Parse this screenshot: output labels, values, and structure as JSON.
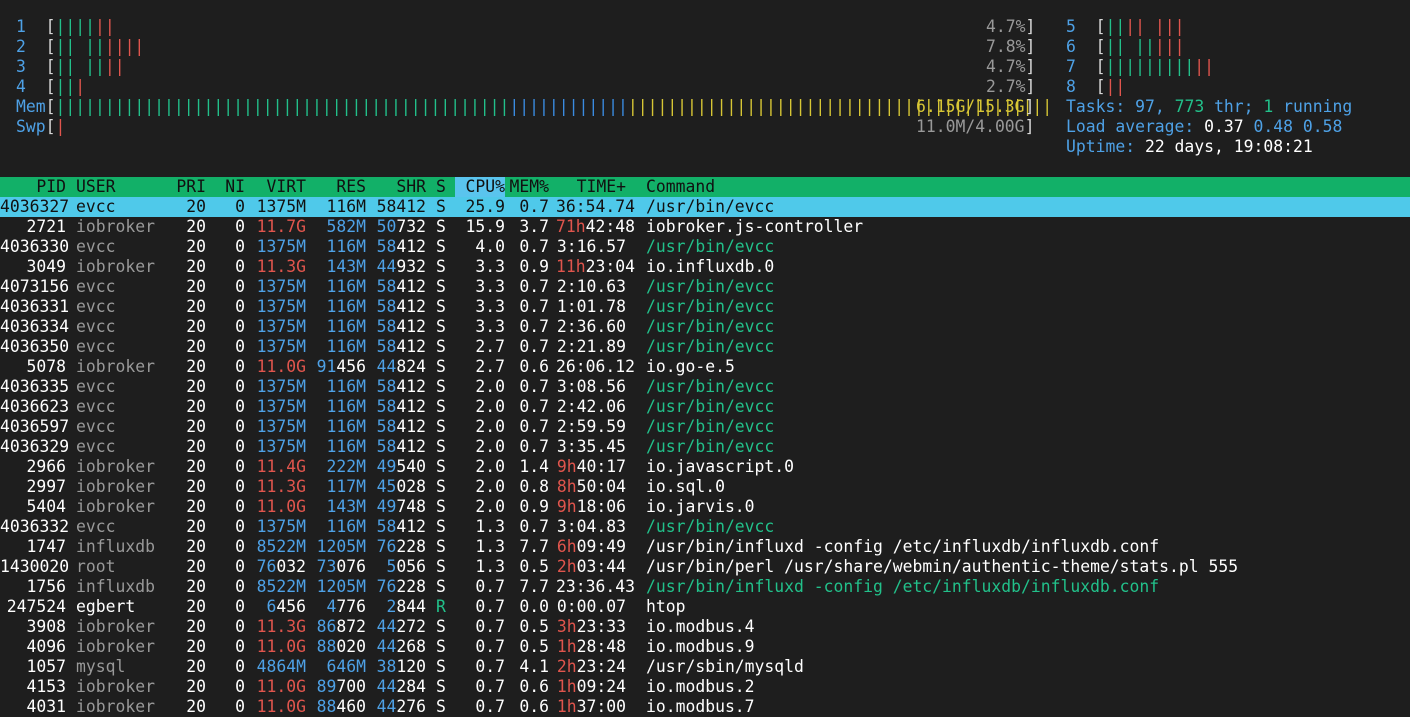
{
  "cpus": [
    {
      "id": "1",
      "green": "||||",
      "red": "||",
      "pct": "4.7%"
    },
    {
      "id": "2",
      "green": "|| ||",
      "red": "||||",
      "pct": "7.8%"
    },
    {
      "id": "3",
      "green": "|| ||",
      "red": "||",
      "pct": "4.7%"
    },
    {
      "id": "4",
      "green": "||",
      "red": "|",
      "pct": "2.7%"
    },
    {
      "id": "5",
      "green": "||",
      "red": "|| |||",
      "pct": ""
    },
    {
      "id": "6",
      "green": "|| ||",
      "red": "|||",
      "pct": ""
    },
    {
      "id": "7",
      "green": "|||||||||",
      "red": "||",
      "pct": ""
    },
    {
      "id": "8",
      "green": "",
      "red": "||",
      "pct": ""
    }
  ],
  "mem": {
    "label": "Mem",
    "green": "||||||||||||||||||||||||||||||||||||||||||||||",
    "blue": "||||||||||||",
    "yellow": "|||||||||||||||||||||||||||||||||||||||||||",
    "value": "6.15G/15.3G"
  },
  "swp": {
    "label": "Swp",
    "red": "|",
    "value": "11.0M/4.00G"
  },
  "tasks": {
    "label": "Tasks:",
    "value": "97,",
    "thr": "773",
    "thr_label": "thr;",
    "running": "1",
    "running_label": "running"
  },
  "load": {
    "label": "Load average:",
    "v1": "0.37",
    "v2": "0.48",
    "v3": "0.58"
  },
  "uptime": {
    "label": "Uptime:",
    "value": "22 days, 19:08:21"
  },
  "header": {
    "pid": "PID",
    "user": "USER",
    "pri": "PRI",
    "ni": "NI",
    "virt": "VIRT",
    "res": "RES",
    "shr": "SHR",
    "s": "S",
    "cpu": "CPU%",
    "mem": "MEM%",
    "time": "TIME+",
    "command": "Command"
  },
  "processes": [
    {
      "pid": "4036327",
      "user": "evcc",
      "pri": "20",
      "ni": "0",
      "virt": "1375M",
      "res": "116M",
      "shr": "58412",
      "s": "S",
      "cpu": "25.9",
      "mem": "0.7",
      "time_h": "",
      "time": "36:54.74",
      "cmd": "/usr/bin/evcc",
      "cmd_args": "",
      "thread": false
    },
    {
      "pid": "2721",
      "user": "iobroker",
      "pri": "20",
      "ni": "0",
      "virt": "11.7G",
      "res": "582M",
      "shr": "50732",
      "s": "S",
      "cpu": "15.9",
      "mem": "3.7",
      "time_h": "71h",
      "time": "42:48",
      "cmd": "iobroker.js-controller",
      "cmd_args": "",
      "thread": false
    },
    {
      "pid": "4036330",
      "user": "evcc",
      "pri": "20",
      "ni": "0",
      "virt": "1375M",
      "res": "116M",
      "shr": "58412",
      "s": "S",
      "cpu": "4.0",
      "mem": "0.7",
      "time_h": "",
      "time": "3:16.57",
      "cmd": "/usr/bin/evcc",
      "cmd_args": "",
      "thread": true
    },
    {
      "pid": "3049",
      "user": "iobroker",
      "pri": "20",
      "ni": "0",
      "virt": "11.3G",
      "res": "143M",
      "shr": "44932",
      "s": "S",
      "cpu": "3.3",
      "mem": "0.9",
      "time_h": "11h",
      "time": "23:04",
      "cmd": "io.influxdb.0",
      "cmd_args": "",
      "thread": false
    },
    {
      "pid": "4073156",
      "user": "evcc",
      "pri": "20",
      "ni": "0",
      "virt": "1375M",
      "res": "116M",
      "shr": "58412",
      "s": "S",
      "cpu": "3.3",
      "mem": "0.7",
      "time_h": "",
      "time": "2:10.63",
      "cmd": "/usr/bin/evcc",
      "cmd_args": "",
      "thread": true
    },
    {
      "pid": "4036331",
      "user": "evcc",
      "pri": "20",
      "ni": "0",
      "virt": "1375M",
      "res": "116M",
      "shr": "58412",
      "s": "S",
      "cpu": "3.3",
      "mem": "0.7",
      "time_h": "",
      "time": "1:01.78",
      "cmd": "/usr/bin/evcc",
      "cmd_args": "",
      "thread": true
    },
    {
      "pid": "4036334",
      "user": "evcc",
      "pri": "20",
      "ni": "0",
      "virt": "1375M",
      "res": "116M",
      "shr": "58412",
      "s": "S",
      "cpu": "3.3",
      "mem": "0.7",
      "time_h": "",
      "time": "2:36.60",
      "cmd": "/usr/bin/evcc",
      "cmd_args": "",
      "thread": true
    },
    {
      "pid": "4036350",
      "user": "evcc",
      "pri": "20",
      "ni": "0",
      "virt": "1375M",
      "res": "116M",
      "shr": "58412",
      "s": "S",
      "cpu": "2.7",
      "mem": "0.7",
      "time_h": "",
      "time": "2:21.89",
      "cmd": "/usr/bin/evcc",
      "cmd_args": "",
      "thread": true
    },
    {
      "pid": "5078",
      "user": "iobroker",
      "pri": "20",
      "ni": "0",
      "virt": "11.0G",
      "res": "91456",
      "shr": "44824",
      "s": "S",
      "cpu": "2.7",
      "mem": "0.6",
      "time_h": "",
      "time": "26:06.12",
      "cmd": "io.go-e.5",
      "cmd_args": "",
      "thread": false
    },
    {
      "pid": "4036335",
      "user": "evcc",
      "pri": "20",
      "ni": "0",
      "virt": "1375M",
      "res": "116M",
      "shr": "58412",
      "s": "S",
      "cpu": "2.0",
      "mem": "0.7",
      "time_h": "",
      "time": "3:08.56",
      "cmd": "/usr/bin/evcc",
      "cmd_args": "",
      "thread": true
    },
    {
      "pid": "4036623",
      "user": "evcc",
      "pri": "20",
      "ni": "0",
      "virt": "1375M",
      "res": "116M",
      "shr": "58412",
      "s": "S",
      "cpu": "2.0",
      "mem": "0.7",
      "time_h": "",
      "time": "2:42.06",
      "cmd": "/usr/bin/evcc",
      "cmd_args": "",
      "thread": true
    },
    {
      "pid": "4036597",
      "user": "evcc",
      "pri": "20",
      "ni": "0",
      "virt": "1375M",
      "res": "116M",
      "shr": "58412",
      "s": "S",
      "cpu": "2.0",
      "mem": "0.7",
      "time_h": "",
      "time": "2:59.59",
      "cmd": "/usr/bin/evcc",
      "cmd_args": "",
      "thread": true
    },
    {
      "pid": "4036329",
      "user": "evcc",
      "pri": "20",
      "ni": "0",
      "virt": "1375M",
      "res": "116M",
      "shr": "58412",
      "s": "S",
      "cpu": "2.0",
      "mem": "0.7",
      "time_h": "",
      "time": "3:35.45",
      "cmd": "/usr/bin/evcc",
      "cmd_args": "",
      "thread": true
    },
    {
      "pid": "2966",
      "user": "iobroker",
      "pri": "20",
      "ni": "0",
      "virt": "11.4G",
      "res": "222M",
      "shr": "49540",
      "s": "S",
      "cpu": "2.0",
      "mem": "1.4",
      "time_h": "9h",
      "time": "40:17",
      "cmd": "io.javascript.0",
      "cmd_args": "",
      "thread": false
    },
    {
      "pid": "2997",
      "user": "iobroker",
      "pri": "20",
      "ni": "0",
      "virt": "11.3G",
      "res": "117M",
      "shr": "45028",
      "s": "S",
      "cpu": "2.0",
      "mem": "0.8",
      "time_h": "8h",
      "time": "50:04",
      "cmd": "io.sql.0",
      "cmd_args": "",
      "thread": false
    },
    {
      "pid": "5404",
      "user": "iobroker",
      "pri": "20",
      "ni": "0",
      "virt": "11.0G",
      "res": "143M",
      "shr": "49748",
      "s": "S",
      "cpu": "2.0",
      "mem": "0.9",
      "time_h": "9h",
      "time": "18:06",
      "cmd": "io.jarvis.0",
      "cmd_args": "",
      "thread": false
    },
    {
      "pid": "4036332",
      "user": "evcc",
      "pri": "20",
      "ni": "0",
      "virt": "1375M",
      "res": "116M",
      "shr": "58412",
      "s": "S",
      "cpu": "1.3",
      "mem": "0.7",
      "time_h": "",
      "time": "3:04.83",
      "cmd": "/usr/bin/evcc",
      "cmd_args": "",
      "thread": true
    },
    {
      "pid": "1747",
      "user": "influxdb",
      "pri": "20",
      "ni": "0",
      "virt": "8522M",
      "res": "1205M",
      "shr": "76228",
      "s": "S",
      "cpu": "1.3",
      "mem": "7.7",
      "time_h": "6h",
      "time": "09:49",
      "cmd": "/usr/bin/influxd",
      "cmd_args": " -config /etc/influxdb/influxdb.conf",
      "thread": false
    },
    {
      "pid": "1430020",
      "user": "root",
      "pri": "20",
      "ni": "0",
      "virt": "76032",
      "res": "73076",
      "shr": "5056",
      "s": "S",
      "cpu": "1.3",
      "mem": "0.5",
      "time_h": "2h",
      "time": "03:44",
      "cmd": "/usr/bin/perl",
      "cmd_args": " /usr/share/webmin/authentic-theme/stats.pl 555",
      "thread": false
    },
    {
      "pid": "1756",
      "user": "influxdb",
      "pri": "20",
      "ni": "0",
      "virt": "8522M",
      "res": "1205M",
      "shr": "76228",
      "s": "S",
      "cpu": "0.7",
      "mem": "7.7",
      "time_h": "",
      "time": "23:36.43",
      "cmd": "/usr/bin/influxd",
      "cmd_args": " -config /etc/influxdb/influxdb.conf",
      "thread": true
    },
    {
      "pid": "247524",
      "user": "egbert",
      "pri": "20",
      "ni": "0",
      "virt": "6456",
      "res": "4776",
      "shr": "2844",
      "s": "R",
      "cpu": "0.7",
      "mem": "0.0",
      "time_h": "",
      "time": "0:00.07",
      "cmd": "htop",
      "cmd_args": "",
      "thread": false
    },
    {
      "pid": "3908",
      "user": "iobroker",
      "pri": "20",
      "ni": "0",
      "virt": "11.3G",
      "res": "86872",
      "shr": "44272",
      "s": "S",
      "cpu": "0.7",
      "mem": "0.5",
      "time_h": "3h",
      "time": "23:33",
      "cmd": "io.modbus.4",
      "cmd_args": "",
      "thread": false
    },
    {
      "pid": "4096",
      "user": "iobroker",
      "pri": "20",
      "ni": "0",
      "virt": "11.0G",
      "res": "88020",
      "shr": "44268",
      "s": "S",
      "cpu": "0.7",
      "mem": "0.5",
      "time_h": "1h",
      "time": "28:48",
      "cmd": "io.modbus.9",
      "cmd_args": "",
      "thread": false
    },
    {
      "pid": "1057",
      "user": "mysql",
      "pri": "20",
      "ni": "0",
      "virt": "4864M",
      "res": "646M",
      "shr": "38120",
      "s": "S",
      "cpu": "0.7",
      "mem": "4.1",
      "time_h": "2h",
      "time": "23:24",
      "cmd": "/usr/sbin/mysqld",
      "cmd_args": "",
      "thread": false
    },
    {
      "pid": "4153",
      "user": "iobroker",
      "pri": "20",
      "ni": "0",
      "virt": "11.0G",
      "res": "89700",
      "shr": "44284",
      "s": "S",
      "cpu": "0.7",
      "mem": "0.6",
      "time_h": "1h",
      "time": "09:24",
      "cmd": "io.modbus.2",
      "cmd_args": "",
      "thread": false
    },
    {
      "pid": "4031",
      "user": "iobroker",
      "pri": "20",
      "ni": "0",
      "virt": "11.0G",
      "res": "88460",
      "shr": "44276",
      "s": "S",
      "cpu": "0.7",
      "mem": "0.6",
      "time_h": "1h",
      "time": "37:00",
      "cmd": "io.modbus.7",
      "cmd_args": "",
      "thread": false
    }
  ],
  "colors": {
    "green": "#22c08a",
    "red": "#e0554d",
    "cyan": "#4ea1e6",
    "yellow": "#d7c635",
    "header_bg": "#12b068",
    "selected_bg": "#4fc9ea"
  }
}
